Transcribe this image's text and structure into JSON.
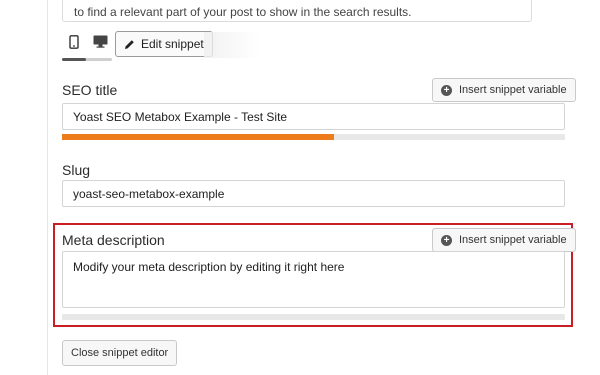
{
  "hint": {
    "text": "to find a relevant part of your post to show in the search results."
  },
  "toolbar": {
    "mobile_icon": "mobile-preview-icon",
    "desktop_icon": "desktop-preview-icon",
    "edit_label": "Edit snippet",
    "edit_icon": "pencil-icon"
  },
  "seo_title": {
    "label": "SEO title",
    "insert_label": "Insert snippet variable",
    "value": "Yoast SEO Metabox Example - Test Site",
    "progress": 0.54
  },
  "slug": {
    "label": "Slug",
    "value": "yoast-seo-metabox-example"
  },
  "meta": {
    "label": "Meta description",
    "insert_label": "Insert snippet variable",
    "value": "Modify your meta description by editing it right here",
    "progress": 0
  },
  "close_label": "Close snippet editor",
  "colors": {
    "progress_fill": "#ee7c1b",
    "highlight": "#c91f24"
  }
}
